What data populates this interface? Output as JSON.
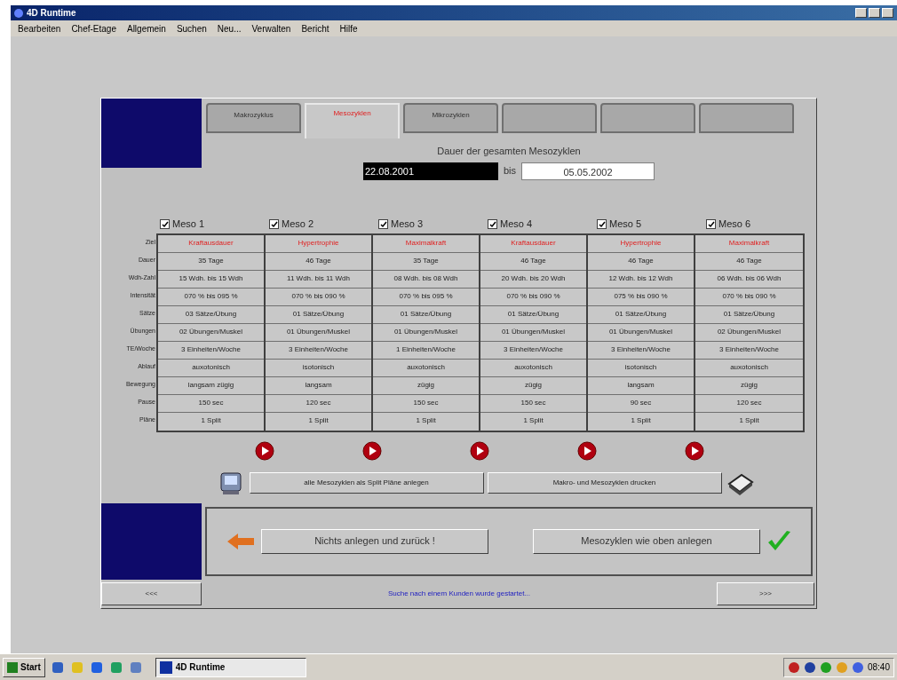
{
  "window": {
    "title": "4D Runtime"
  },
  "menu": [
    "Bearbeiten",
    "Chef-Etage",
    "Allgemein",
    "Suchen",
    "Neu...",
    "Verwalten",
    "Bericht",
    "Hilfe"
  ],
  "tabs": [
    {
      "label": "Makrozyklus",
      "selected": false
    },
    {
      "label": "Mesozyklen",
      "selected": true
    },
    {
      "label": "Mikrozyklen",
      "selected": false
    }
  ],
  "period": {
    "title": "Dauer der gesamten Mesozyklen",
    "from": "22.08.2001",
    "separator": "bis",
    "to": "05.05.2002"
  },
  "table": {
    "row_labels": [
      "Ziel",
      "Dauer",
      "Wdh-Zahl",
      "Intensität",
      "Sätze",
      "Übungen",
      "TE/Woche",
      "Ablauf",
      "Bewegung",
      "Pause",
      "Pläne"
    ],
    "columns": [
      {
        "label": "Meso 1",
        "checked": true,
        "goal": "Kraftausdauer",
        "cells": [
          "35 Tage",
          "15 Wdh. bis 15 Wdh",
          "070 % bis 095 %",
          "03 Sätze/Übung",
          "02 Übungen/Muskel",
          "3 Einheiten/Woche",
          "auxotonisch",
          "langsam zügig",
          "150 sec",
          "1 Split"
        ]
      },
      {
        "label": "Meso 2",
        "checked": true,
        "goal": "Hypertrophie",
        "cells": [
          "46 Tage",
          "11 Wdh. bis 11 Wdh",
          "070 % bis 090 %",
          "01 Sätze/Übung",
          "01 Übungen/Muskel",
          "3 Einheiten/Woche",
          "isotonisch",
          "langsam",
          "120 sec",
          "1 Split"
        ]
      },
      {
        "label": "Meso 3",
        "checked": true,
        "goal": "Maximalkraft",
        "cells": [
          "35 Tage",
          "08 Wdh. bis 08 Wdh",
          "070 % bis 095 %",
          "01 Sätze/Übung",
          "01 Übungen/Muskel",
          "1 Einheiten/Woche",
          "auxotonisch",
          "zügig",
          "150 sec",
          "1 Split"
        ]
      },
      {
        "label": "Meso 4",
        "checked": true,
        "goal": "Kraftausdauer",
        "cells": [
          "46 Tage",
          "20 Wdh. bis 20 Wdh",
          "070 % bis 090 %",
          "01 Sätze/Übung",
          "01 Übungen/Muskel",
          "3 Einheiten/Woche",
          "auxotonisch",
          "zügig",
          "150 sec",
          "1 Split"
        ]
      },
      {
        "label": "Meso 5",
        "checked": true,
        "goal": "Hypertrophie",
        "cells": [
          "46 Tage",
          "12 Wdh. bis 12 Wdh",
          "075 % bis 090 %",
          "01 Sätze/Übung",
          "01 Übungen/Muskel",
          "3 Einheiten/Woche",
          "isotonisch",
          "langsam",
          "90 sec",
          "1 Split"
        ]
      },
      {
        "label": "Meso 6",
        "checked": true,
        "goal": "Maximalkraft",
        "cells": [
          "46 Tage",
          "06 Wdh. bis 06 Wdh",
          "070 % bis 090 %",
          "01 Sätze/Übung",
          "02 Übungen/Muskel",
          "3 Einheiten/Woche",
          "auxotonisch",
          "zügig",
          "120 sec",
          "1 Split"
        ]
      }
    ]
  },
  "actions": [
    "alle Mesozyklen als Split Pläne anlegen",
    "Makro- und Mesozyklen drucken"
  ],
  "footer_buttons": [
    "Nichts anlegen und zurück !",
    "Mesozyklen wie oben anlegen"
  ],
  "status": {
    "left": "<<<",
    "message": "Suche nach einem Kunden wurde gestartet...",
    "right": ">>>"
  },
  "taskbar": {
    "start": "Start",
    "task": "4D Runtime",
    "clock": "08:40"
  }
}
